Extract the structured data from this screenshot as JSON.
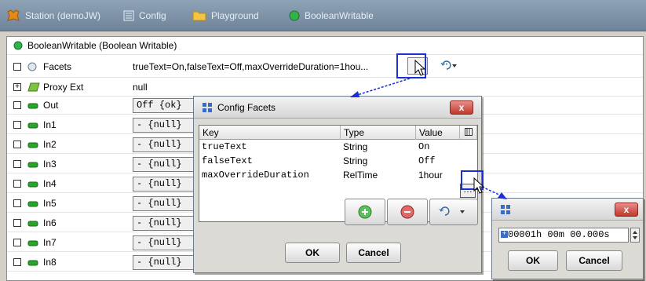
{
  "breadcrumb": [
    {
      "label": "Station (demoJW)",
      "icon": "station-icon"
    },
    {
      "label": "Config",
      "icon": "config-icon"
    },
    {
      "label": "Playground",
      "icon": "folder-icon"
    },
    {
      "label": "BooleanWritable",
      "icon": "boolean-writable-icon"
    }
  ],
  "sheet": {
    "header": "BooleanWritable  (Boolean Writable)",
    "facets": {
      "label": "Facets",
      "value": "trueText=On,falseText=Off,maxOverrideDuration=1hou..."
    },
    "proxy": {
      "label": "Proxy Ext",
      "value": "null"
    },
    "rows": [
      {
        "label": "Out",
        "value": "Off {ok}"
      },
      {
        "label": "In1",
        "value": "- {null}"
      },
      {
        "label": "In2",
        "value": "- {null}"
      },
      {
        "label": "In3",
        "value": "- {null}"
      },
      {
        "label": "In4",
        "value": "- {null}"
      },
      {
        "label": "In5",
        "value": "- {null}"
      },
      {
        "label": "In6",
        "value": "- {null}"
      },
      {
        "label": "In7",
        "value": "- {null}"
      },
      {
        "label": "In8",
        "value": "- {null}"
      }
    ]
  },
  "config_facets": {
    "title": "Config Facets",
    "close": "x",
    "columns": [
      "Key",
      "Type",
      "Value"
    ],
    "rows": [
      {
        "key": "trueText",
        "type": "String",
        "value": "On"
      },
      {
        "key": "falseText",
        "type": "String",
        "value": "Off"
      },
      {
        "key": "maxOverrideDuration",
        "type": "RelTime",
        "value": "1hour"
      }
    ],
    "ok": "OK",
    "cancel": "Cancel"
  },
  "reltime_dialog": {
    "close": "x",
    "value": "00001h 00m 00.000s",
    "ok": "OK",
    "cancel": "Cancel"
  },
  "colors": {
    "highlight": "#1a2fd6",
    "slot_green": "#29a329",
    "close_red": "#c0392b"
  }
}
